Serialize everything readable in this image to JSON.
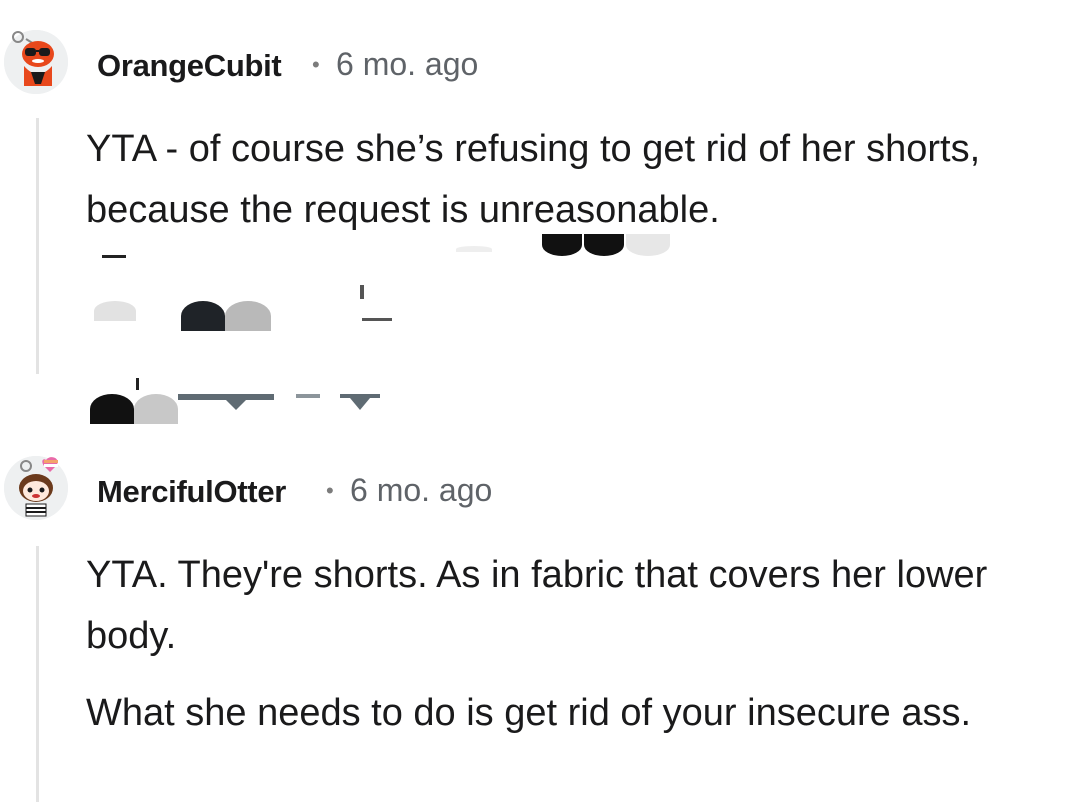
{
  "comments": [
    {
      "username": "OrangeCubit",
      "separator": "•",
      "time": "6 mo. ago",
      "avatar_icon": "snoo-avatar-sunglasses",
      "paragraphs": [
        "YTA - of course she’s refusing to get rid of her shorts, because the request is unreasonable."
      ]
    },
    {
      "username": "MercifulOtter",
      "separator": "•",
      "time": "6 mo. ago",
      "avatar_icon": "snoo-avatar-heart",
      "paragraphs": [
        "YTA. They're shorts. As in fabric that covers her lower body.",
        "What she needs to do is get rid of your insecure ass."
      ]
    }
  ],
  "colors": {
    "text": "#1a1a1b",
    "meta": "#5f6368",
    "thread_line": "#e3e3e3",
    "avatar1_accent": "#e8481c",
    "avatar2_accent": "#6b3a1c"
  }
}
